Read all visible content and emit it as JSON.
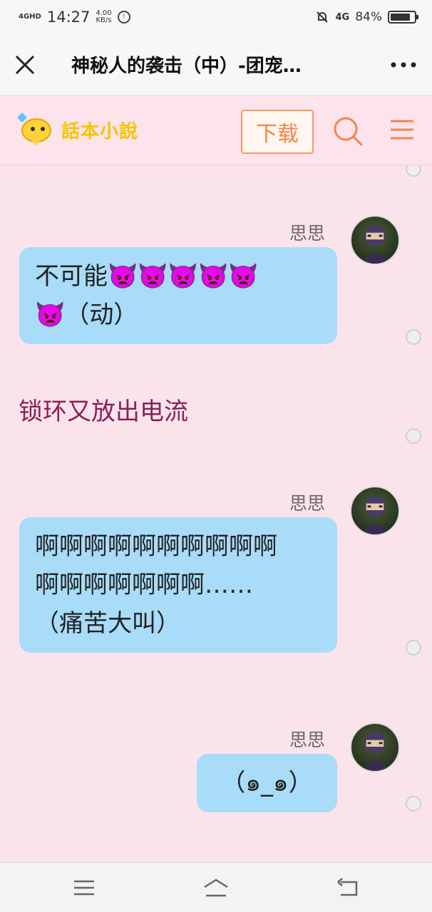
{
  "status_bar": {
    "network": "4GHD",
    "time": "14:27",
    "speed_value": "4.00",
    "speed_unit": "KB/s",
    "network_right": "4G",
    "battery": "84%",
    "battery_level": 0.84
  },
  "title_bar": {
    "title": "神秘人的袭击（中）-团宠…"
  },
  "site_header": {
    "logo_text": "話本小說",
    "download_label": "下载"
  },
  "messages": [
    {
      "type": "bubble",
      "sender": "思思",
      "lines": [
        "不可能👿👿👿👿👿",
        "👿（动）"
      ]
    },
    {
      "type": "narration",
      "text": "锁环又放出电流"
    },
    {
      "type": "bubble",
      "sender": "思思",
      "lines": [
        "啊啊啊啊啊啊啊啊啊啊",
        "啊啊啊啊啊啊啊……",
        "（痛苦大叫）"
      ]
    },
    {
      "type": "bubble",
      "sender": "思思",
      "lines": [
        "（๑_๑）"
      ]
    }
  ],
  "colors": {
    "page_background": "#fbe3ec",
    "bubble": "#a8dcf8",
    "narration": "#8a1f55",
    "accent": "#f0874c"
  },
  "icons": {
    "close": "close-icon",
    "more": "more-icon",
    "search": "search-icon",
    "menu": "menu-icon",
    "nav_menu": "nav-menu-icon",
    "nav_home": "nav-home-icon",
    "nav_back": "nav-back-icon"
  }
}
